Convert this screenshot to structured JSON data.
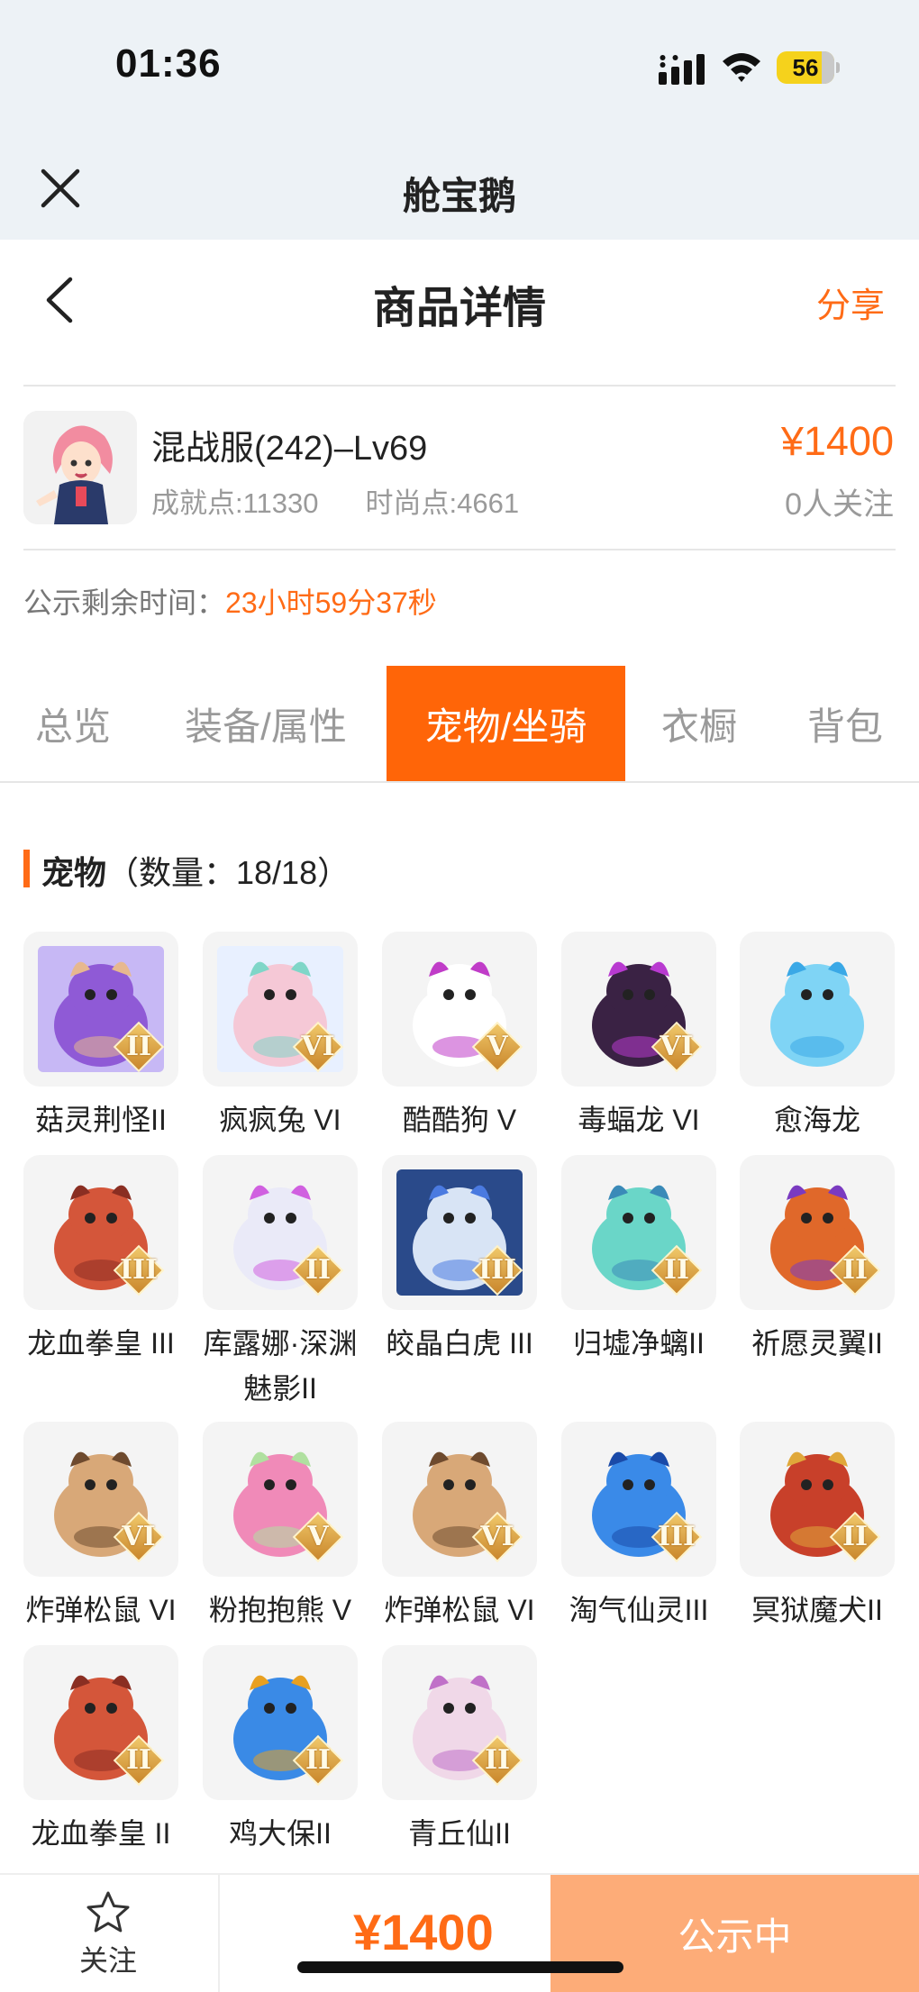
{
  "status_bar": {
    "time": "01:36",
    "battery": "56"
  },
  "app_header": {
    "title": "舱宝鹅"
  },
  "page_header": {
    "title": "商品详情",
    "share": "分享"
  },
  "product": {
    "name": "混战服(242)–Lv69",
    "achievement": "成就点:11330",
    "fashion": "时尚点:4661",
    "price": "¥1400",
    "followers": "0人关注"
  },
  "countdown": {
    "label": "公示剩余时间：",
    "value": "23小时59分37秒"
  },
  "tabs": [
    {
      "label": "总览"
    },
    {
      "label": "装备/属性"
    },
    {
      "label": "宠物/坐骑"
    },
    {
      "label": "衣橱"
    },
    {
      "label": "背包"
    }
  ],
  "section": {
    "title": "宠物",
    "count": "（数量：18/18）"
  },
  "pets": [
    {
      "name": "菇灵荆怪II",
      "rank": "II",
      "colors": [
        "#c7b8f5",
        "#8f5ad6",
        "#e7b88f"
      ]
    },
    {
      "name": "疯疯兔 VI",
      "rank": "VI",
      "colors": [
        "#e8f0ff",
        "#f5c8d6",
        "#7fd6c8"
      ]
    },
    {
      "name": "酷酷狗 V",
      "rank": "V",
      "colors": [
        "#f4f4f4",
        "#ffffff",
        "#c03cc8"
      ]
    },
    {
      "name": "毒蝠龙 VI",
      "rank": "VI",
      "colors": [
        "#f4f4f4",
        "#3a2244",
        "#b83ad0"
      ]
    },
    {
      "name": "愈海龙",
      "rank": "",
      "colors": [
        "#f4f4f4",
        "#7fd4f5",
        "#3aa8e6"
      ]
    },
    {
      "name": "龙血拳皇 III",
      "rank": "III",
      "colors": [
        "#f4f4f4",
        "#d4563a",
        "#8a2e22"
      ]
    },
    {
      "name": "库露娜·深渊魅影II",
      "rank": "II",
      "colors": [
        "#f4f4f4",
        "#eaeaf8",
        "#d060e0"
      ]
    },
    {
      "name": "皎晶白虎 III",
      "rank": "III",
      "colors": [
        "#2a4a8a",
        "#d8e4f5",
        "#4a7ae0"
      ]
    },
    {
      "name": "归墟净螭II",
      "rank": "II",
      "colors": [
        "#f4f4f4",
        "#6ad6c8",
        "#3a8ab8"
      ]
    },
    {
      "name": "祈愿灵翼II",
      "rank": "II",
      "colors": [
        "#f4f4f4",
        "#e0682a",
        "#7a3ac0"
      ]
    },
    {
      "name": "炸弹松鼠 VI",
      "rank": "VI",
      "colors": [
        "#f4f4f4",
        "#d8a878",
        "#6e4a2e"
      ]
    },
    {
      "name": "粉抱抱熊 V",
      "rank": "V",
      "colors": [
        "#f4f4f4",
        "#f08ab8",
        "#b0e0a0"
      ]
    },
    {
      "name": "炸弹松鼠 VI",
      "rank": "VI",
      "colors": [
        "#f4f4f4",
        "#d8a878",
        "#6e4a2e"
      ]
    },
    {
      "name": "淘气仙灵III",
      "rank": "III",
      "colors": [
        "#f4f4f4",
        "#3a8ae8",
        "#1a4aa8"
      ]
    },
    {
      "name": "冥狱魔犬II",
      "rank": "II",
      "colors": [
        "#f4f4f4",
        "#c8402a",
        "#e0a83a"
      ]
    },
    {
      "name": "龙血拳皇 II",
      "rank": "II",
      "colors": [
        "#f4f4f4",
        "#d4563a",
        "#8a2e22"
      ]
    },
    {
      "name": "鸡大保II",
      "rank": "II",
      "colors": [
        "#f4f4f4",
        "#3a8ae6",
        "#e8a020"
      ]
    },
    {
      "name": "青丘仙II",
      "rank": "II",
      "colors": [
        "#f4f4f4",
        "#f0d8e8",
        "#c070c8"
      ]
    }
  ],
  "bottom_bar": {
    "follow": "关注",
    "price": "¥1400",
    "action": "公示中"
  },
  "colors": {
    "accent": "#ff6b16",
    "tab_active": "#ff6508",
    "cta": "#fdac78"
  }
}
